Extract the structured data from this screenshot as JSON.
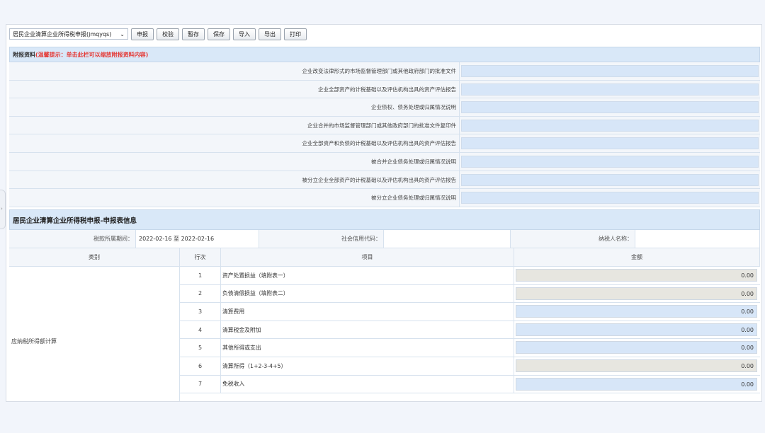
{
  "toolbar": {
    "report_select": "居民企业清算企业所得税申报(jmqyqs)",
    "buttons": [
      "申报",
      "校验",
      "暂存",
      "保存",
      "导入",
      "导出",
      "打印"
    ]
  },
  "attach": {
    "title": "附报资料",
    "hint": "(温馨提示：单击此栏可以缩放附报资料内容)",
    "rows": [
      "企业改变法律形式的市场监督管理部门或其他政府部门的批准文件",
      "企业全部资产的计税基础以及评估机构出具的资产评估报告",
      "企业债权、债务处理或归属情况说明",
      "企业合并的市场监督管理部门或其他政府部门的批准文件复印件",
      "企业全部资产和负债的计税基础以及评估机构出具的资产评估报告",
      "被合并企业债务处理或归属情况说明",
      "被分立企业全部资产的计税基础以及评估机构出具的资产评估报告",
      "被分立企业债务处理或归属情况说明"
    ]
  },
  "report": {
    "title": "居民企业清算企业所得税申报-申报表信息",
    "period_label": "税款所属期间：",
    "period_value": "2022-02-16 至 2022-02-16",
    "credit_code_label": "社会信用代码：",
    "credit_code_value": "",
    "taxpayer_label": "纳税人名称：",
    "taxpayer_value": ""
  },
  "table": {
    "headers": [
      "类别",
      "行次",
      "项目",
      "金额"
    ],
    "category": "应纳税所得额计算",
    "rows": [
      {
        "no": "1",
        "item": "资产处置损益（填附表一）",
        "amount": "0.00",
        "style": "gray"
      },
      {
        "no": "2",
        "item": "负债清偿损益（填附表二）",
        "amount": "0.00",
        "style": "gray"
      },
      {
        "no": "3",
        "item": "清算费用",
        "amount": "0.00",
        "style": "blue"
      },
      {
        "no": "4",
        "item": "清算税金及附加",
        "amount": "0.00",
        "style": "blue"
      },
      {
        "no": "5",
        "item": "其他所得或支出",
        "amount": "0.00",
        "style": "blue"
      },
      {
        "no": "6",
        "item": "清算所得（1+2-3-4+5）",
        "amount": "0.00",
        "style": "gray"
      },
      {
        "no": "7",
        "item": "免税收入",
        "amount": "0.00",
        "style": "blue"
      }
    ]
  }
}
